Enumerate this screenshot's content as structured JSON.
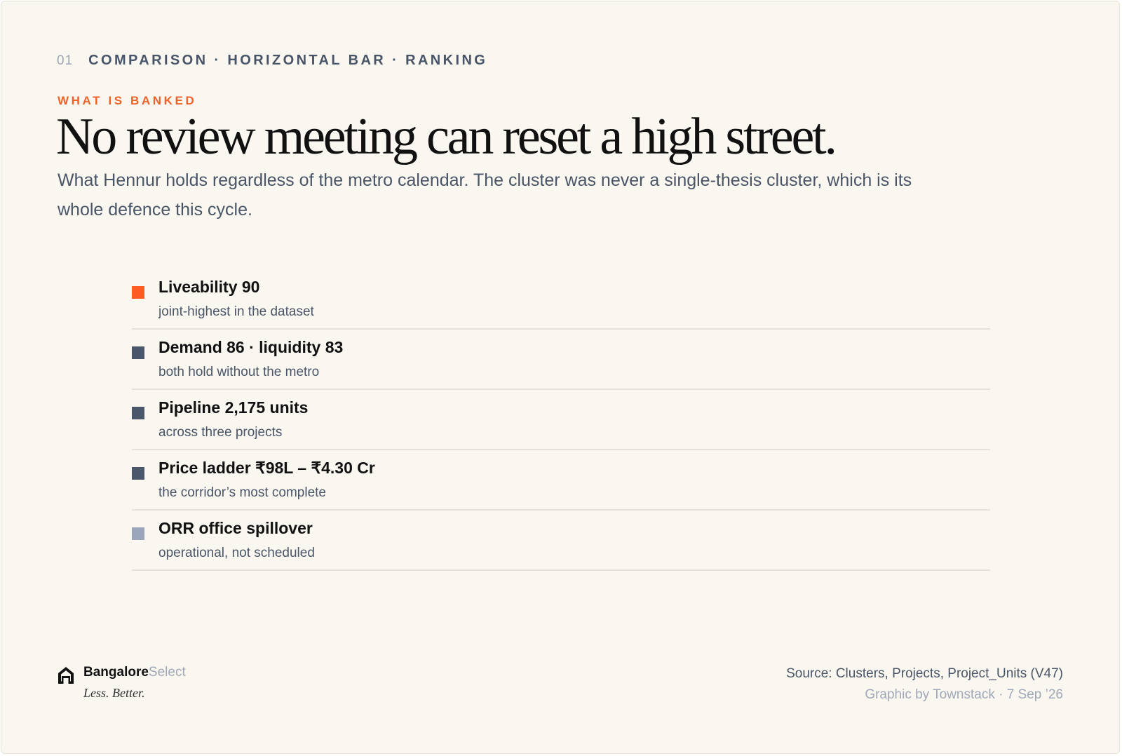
{
  "header": {
    "number": "01",
    "kicker": "COMPARISON · HORIZONTAL BAR · RANKING",
    "eyebrow": "WHAT IS BANKED",
    "headline": "No review meeting can reset a high street.",
    "subhead": "What Hennur holds regardless of the metro calendar. The cluster was never a single-thesis cluster, which is its whole defence this cycle."
  },
  "items": [
    {
      "title": "Liveability 90",
      "subtitle": "joint-highest in the dataset",
      "color": "#ff5b24"
    },
    {
      "title": "Demand 86 · liquidity 83",
      "subtitle": "both hold without the metro",
      "color": "#4a566a"
    },
    {
      "title": "Pipeline 2,175 units",
      "subtitle": "across three projects",
      "color": "#4a566a"
    },
    {
      "title": "Price ladder ₹98L – ₹4.30 Cr",
      "subtitle": "the corridor’s most complete",
      "color": "#4a566a"
    },
    {
      "title": "ORR office spillover",
      "subtitle": "operational, not scheduled",
      "color": "#9ba6ba"
    }
  ],
  "footer": {
    "brand_primary": "Bangalore",
    "brand_secondary": "Select",
    "tagline": "Less. Better.",
    "logo_icon": "house-icon",
    "source": "Source: Clusters, Projects, Project_Units (V47)",
    "credit": "Graphic by Townstack · 7 Sep ’26"
  }
}
